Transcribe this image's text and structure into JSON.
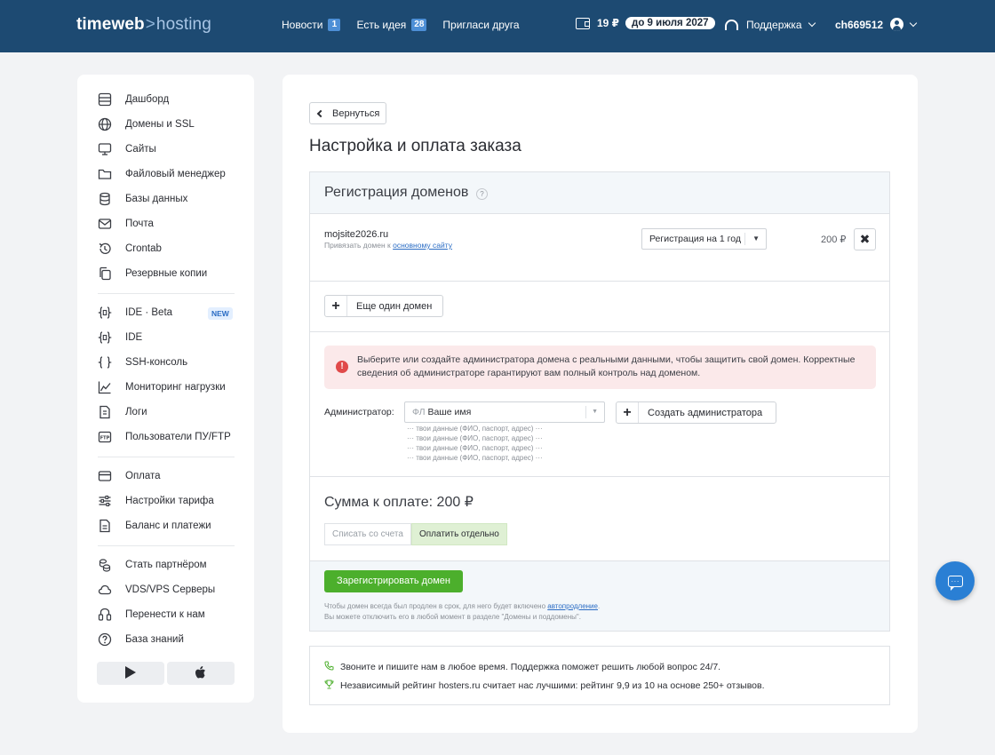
{
  "header": {
    "logo_left": "timeweb",
    "logo_sep": ">",
    "logo_right": "hosting",
    "nav": [
      {
        "label": "Новости",
        "badge": "1"
      },
      {
        "label": "Есть идея",
        "badge": "28"
      },
      {
        "label": "Пригласи друга"
      }
    ],
    "balance_amount": "19 ₽",
    "balance_until": "до 9 июля 2027",
    "support_label": "Поддержка",
    "username": "ch669512"
  },
  "sidebar": {
    "items": [
      {
        "label": "Дашборд",
        "icon": "dashboard-icon"
      },
      {
        "label": "Домены и SSL",
        "icon": "globe-icon"
      },
      {
        "label": "Сайты",
        "icon": "monitor-icon"
      },
      {
        "label": "Файловый менеджер",
        "icon": "folder-icon"
      },
      {
        "label": "Базы данных",
        "icon": "database-icon"
      },
      {
        "label": "Почта",
        "icon": "mail-icon"
      },
      {
        "label": "Crontab",
        "icon": "history-icon"
      },
      {
        "label": "Резервные копии",
        "icon": "copy-icon"
      },
      {
        "label": "IDE · Beta",
        "icon": "ide-icon"
      },
      {
        "label": "IDE",
        "icon": "ide-icon"
      },
      {
        "label": "SSH-консоль",
        "icon": "braces-icon"
      },
      {
        "label": "Мониторинг нагрузки",
        "icon": "chart-icon"
      },
      {
        "label": "Логи",
        "icon": "log-file-icon"
      },
      {
        "label": "Пользователи ПУ/FTP",
        "icon": "ftp-icon"
      },
      {
        "label": "Оплата",
        "icon": "card-icon"
      },
      {
        "label": "Настройки тарифа",
        "icon": "sliders-icon"
      },
      {
        "label": "Баланс и платежи",
        "icon": "document-icon"
      },
      {
        "label": "Стать партнёром",
        "icon": "coins-icon"
      },
      {
        "label": "VDS/VPS Серверы",
        "icon": "cloud-icon"
      },
      {
        "label": "Перенести к нам",
        "icon": "transfer-icon"
      },
      {
        "label": "База знаний",
        "icon": "question-icon"
      }
    ],
    "new_badge": "NEW",
    "store_buttons": [
      "google-play-icon",
      "apple-icon"
    ]
  },
  "main": {
    "back_label": "Вернуться",
    "title": "Настройка и оплата заказа",
    "section_title": "Регистрация доменов",
    "help_mark": "?",
    "domain": {
      "name": "mojsite2026.ru",
      "sub_prefix": "Привязать домен к",
      "sub_link": "основному сайту",
      "period": "Регистрация на 1 год",
      "price": "200 ₽"
    },
    "add_domain_label": "Еще один домен",
    "alert_text": "Выберите или создайте администратора домена с реальными данными, чтобы защитить свой домен. Корректные сведения об администраторе гарантируют вам полный контроль над доменом.",
    "admin_label": "Администратор:",
    "admin_prefix": "ФЛ",
    "admin_value": "Ваше имя",
    "admin_options": [
      "··· твои данные (ФИО, паспорт, адрес) ···",
      "··· твои данные (ФИО, паспорт, адрес) ···",
      "··· твои данные (ФИО, паспорт, адрес) ···",
      "··· твои данные (ФИО, паспорт, адрес) ···"
    ],
    "create_admin_label": "Создать администратора",
    "sum_label": "Сумма к оплате: 200 ₽",
    "pay_tabs": [
      "Списать со счета",
      "Оплатить отдельно"
    ],
    "register_label": "Зарегистрировать домен",
    "note_line1_prefix": "Чтобы домен всегда был продлен в срок, для него будет включено",
    "note_line1_link": "автопродление",
    "note_line1_suffix": ".",
    "note_line2": "Вы можете отключить его в любой момент в разделе \"Домены и поддомены\".",
    "info_lines": [
      "Звоните и пишите нам в любое время. Поддержка поможет решить любой вопрос 24/7.",
      "Независимый рейтинг hosters.ru считает нас лучшими: рейтинг 9,9 из 10 на основе 250+ отзывов."
    ]
  },
  "colors": {
    "header_bg": "#1d4a72",
    "accent": "#4d8fd6",
    "register_button": "#4caf2c",
    "alert_bg": "#fbe9ea",
    "chat_button": "#2a7fd4"
  }
}
